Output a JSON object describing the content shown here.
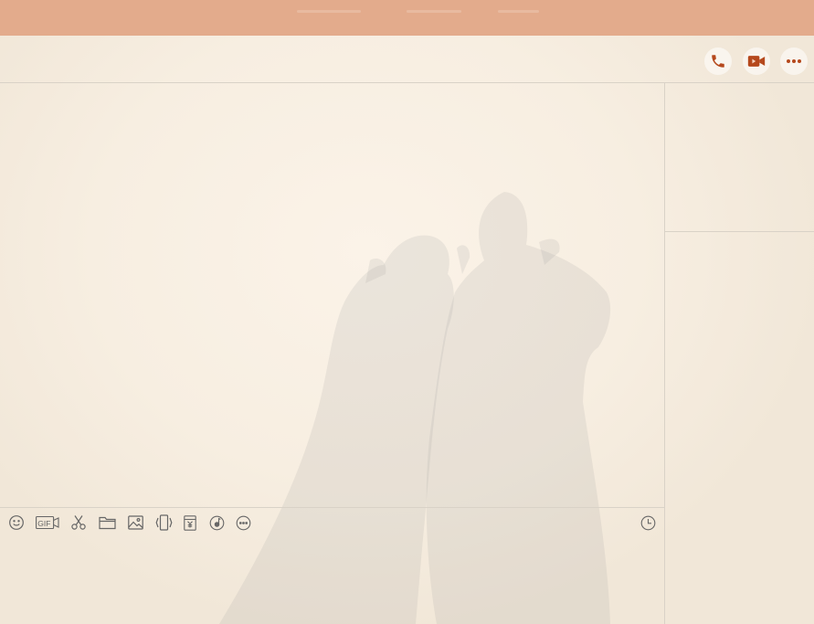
{
  "window": {
    "titlebar_color": "#e3ab8c"
  },
  "header": {
    "actions": [
      {
        "name": "voice-call",
        "icon": "phone-icon"
      },
      {
        "name": "video-call",
        "icon": "video-camera-icon"
      },
      {
        "name": "more",
        "icon": "more-dots-icon"
      }
    ],
    "accent_color": "#b5481c"
  },
  "composer": {
    "toolbar": [
      {
        "name": "emoji",
        "icon": "smiley-icon"
      },
      {
        "name": "gif",
        "icon": "gif-icon",
        "label": "GIF"
      },
      {
        "name": "screenshot",
        "icon": "scissors-icon"
      },
      {
        "name": "file",
        "icon": "folder-icon"
      },
      {
        "name": "image",
        "icon": "image-icon"
      },
      {
        "name": "shake",
        "icon": "shake-phone-icon"
      },
      {
        "name": "red-envelope",
        "icon": "red-envelope-icon"
      },
      {
        "name": "music",
        "icon": "music-icon"
      },
      {
        "name": "more-tools",
        "icon": "more-circle-icon"
      }
    ],
    "history_icon": "clock-icon",
    "input_value": "",
    "icon_color": "#666666"
  }
}
